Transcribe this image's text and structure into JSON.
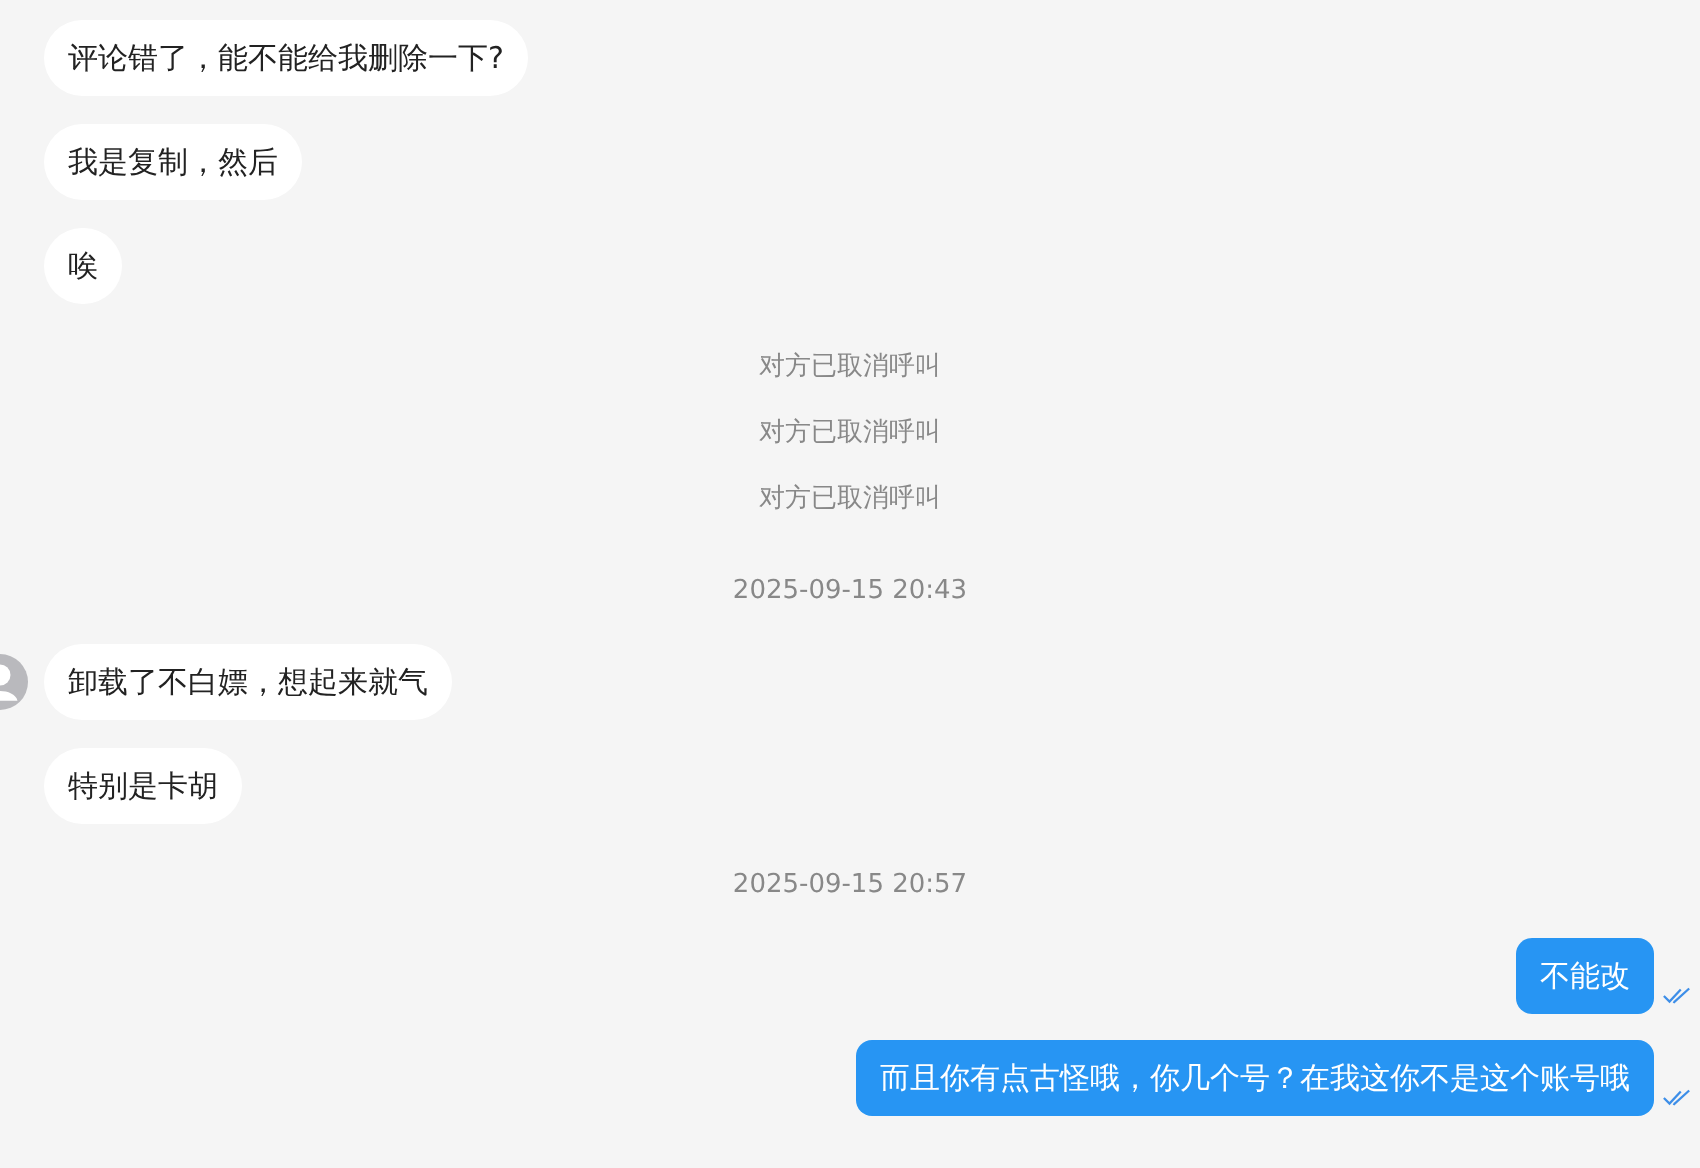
{
  "messages": [
    {
      "kind": "incoming",
      "text": "评论错了，能不能给我删除一下?",
      "avatar": false
    },
    {
      "kind": "incoming",
      "text": "我是复制，然后",
      "avatar": false
    },
    {
      "kind": "incoming",
      "text": "唉",
      "avatar": false
    },
    {
      "kind": "system",
      "text": "对方已取消呼叫"
    },
    {
      "kind": "system",
      "text": "对方已取消呼叫"
    },
    {
      "kind": "system",
      "text": "对方已取消呼叫"
    },
    {
      "kind": "time",
      "text": "2025-09-15 20:43"
    },
    {
      "kind": "incoming",
      "text": "卸载了不白嫖，想起来就气",
      "avatar": true
    },
    {
      "kind": "incoming",
      "text": "特别是卡胡",
      "avatar": false
    },
    {
      "kind": "time",
      "text": "2025-09-15 20:57"
    },
    {
      "kind": "outgoing",
      "text": "不能改",
      "read": true
    },
    {
      "kind": "outgoing",
      "text": "而且你有点古怪哦，你几个号？在我这你不是这个账号哦",
      "read": true
    }
  ]
}
